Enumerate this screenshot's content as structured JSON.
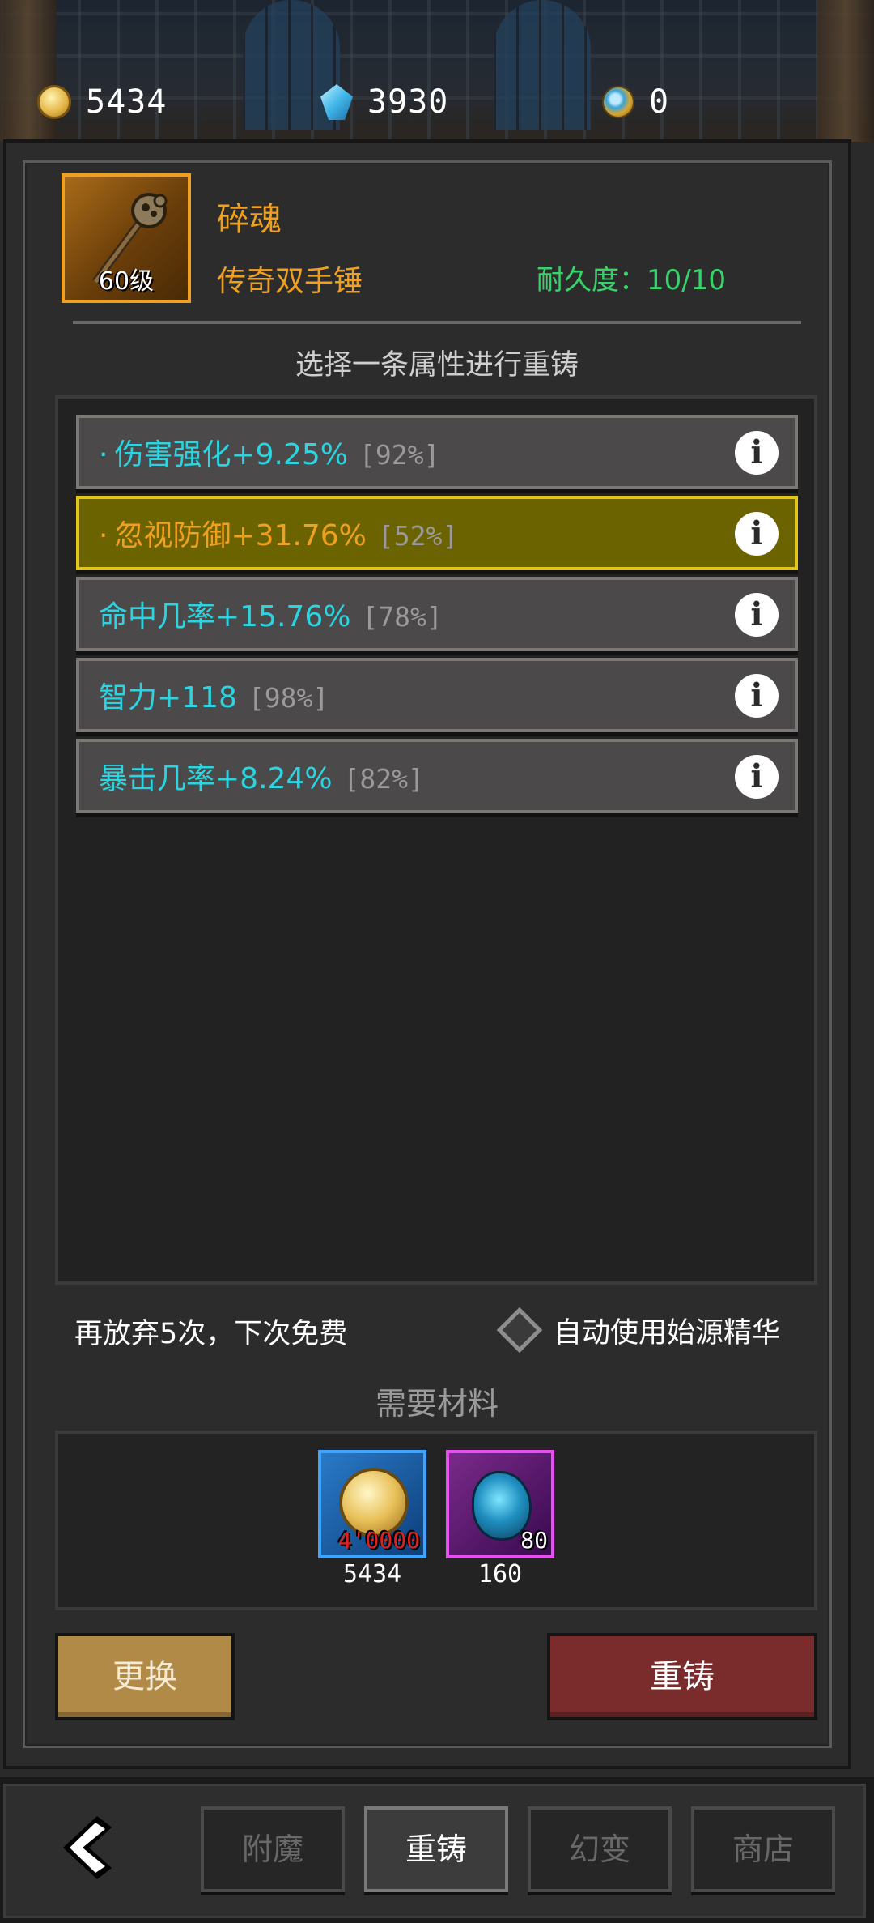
{
  "currency": {
    "gold": "5434",
    "crystal": "3930",
    "orb": "0"
  },
  "item": {
    "name": "碎魂",
    "type": "传奇双手锤",
    "level": "60级",
    "durability": "耐久度：10/10"
  },
  "instruction": "选择一条属性进行重铸",
  "attributes": [
    {
      "bullet": "·",
      "text": "伤害强化+9.25%",
      "percent": "[92%]",
      "selected": false
    },
    {
      "bullet": "·",
      "text": "忽视防御+31.76%",
      "percent": "[52%]",
      "selected": true
    },
    {
      "bullet": "",
      "text": "命中几率+15.76%",
      "percent": "[78%]",
      "selected": false
    },
    {
      "bullet": "",
      "text": "智力+118",
      "percent": "[98%]",
      "selected": false
    },
    {
      "bullet": "",
      "text": "暴击几率+8.24%",
      "percent": "[82%]",
      "selected": false
    }
  ],
  "info_glyph": "i",
  "free_hint": "再放弃5次，下次免费",
  "auto_use_label": "自动使用始源精华",
  "materials_title": "需要材料",
  "materials": [
    {
      "icon": "gold-coin-icon",
      "need": "4'0000",
      "have": "5434",
      "need_color": "#e02020"
    },
    {
      "icon": "blue-stone-icon",
      "need": "80",
      "have": "160",
      "need_color": "#ffffff"
    }
  ],
  "buttons": {
    "replace": "更换",
    "reforge": "重铸"
  },
  "nav_tabs": [
    {
      "label": "附魔",
      "active": false
    },
    {
      "label": "重铸",
      "active": true
    },
    {
      "label": "幻变",
      "active": false
    },
    {
      "label": "商店",
      "active": false
    }
  ],
  "colors": {
    "legendary": "#f0a020",
    "attribute": "#2ad4e0",
    "durability": "#36d36a",
    "selected_bg": "#6b6300",
    "selected_border": "#e3c516"
  }
}
